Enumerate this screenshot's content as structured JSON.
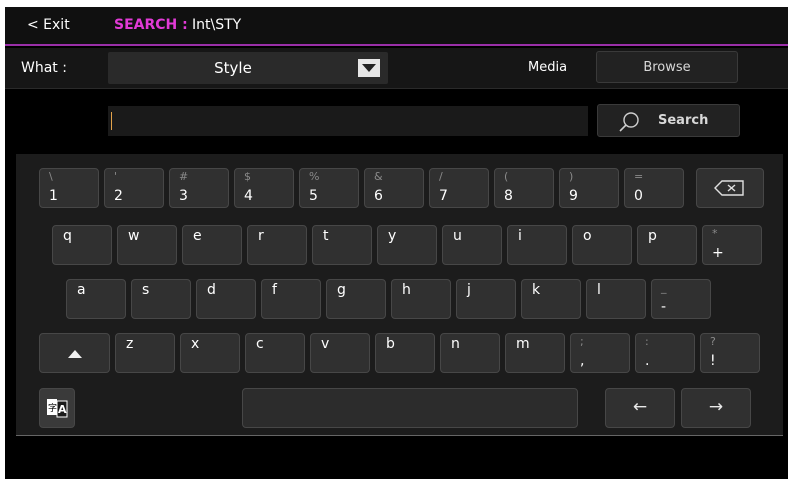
{
  "topbar": {
    "exit_label": "< Exit",
    "search_label": "SEARCH :",
    "search_path": "Int\\STY"
  },
  "what_row": {
    "what_label": "What :",
    "style_value": "Style",
    "media_label": "Media",
    "browse_label": "Browse"
  },
  "search": {
    "value": "",
    "button_label": "Search"
  },
  "keyboard": {
    "row1": [
      {
        "s": "\\",
        "m": "1"
      },
      {
        "s": "'",
        "m": "2"
      },
      {
        "s": "#",
        "m": "3"
      },
      {
        "s": "$",
        "m": "4"
      },
      {
        "s": "%",
        "m": "5"
      },
      {
        "s": "&",
        "m": "6"
      },
      {
        "s": "/",
        "m": "7"
      },
      {
        "s": "(",
        "m": "8"
      },
      {
        "s": ")",
        "m": "9"
      },
      {
        "s": "=",
        "m": "0"
      }
    ],
    "row2": [
      {
        "l": "q"
      },
      {
        "l": "w"
      },
      {
        "l": "e"
      },
      {
        "l": "r"
      },
      {
        "l": "t"
      },
      {
        "l": "y"
      },
      {
        "l": "u"
      },
      {
        "l": "i"
      },
      {
        "l": "o"
      },
      {
        "l": "p"
      },
      {
        "s": "*",
        "m": "+"
      }
    ],
    "row3": [
      {
        "l": "a"
      },
      {
        "l": "s"
      },
      {
        "l": "d"
      },
      {
        "l": "f"
      },
      {
        "l": "g"
      },
      {
        "l": "h"
      },
      {
        "l": "j"
      },
      {
        "l": "k"
      },
      {
        "l": "l"
      },
      {
        "s": "_",
        "m": "-"
      }
    ],
    "row4": [
      {
        "l": "z"
      },
      {
        "l": "x"
      },
      {
        "l": "c"
      },
      {
        "l": "v"
      },
      {
        "l": "b"
      },
      {
        "l": "n"
      },
      {
        "l": "m"
      },
      {
        "s": ";",
        "m": ","
      },
      {
        "s": ":",
        "m": "."
      },
      {
        "s": "?",
        "m": "!"
      }
    ],
    "icons": {
      "backspace": "backspace-icon",
      "shift": "shift-icon",
      "language": "language-icon",
      "search": "search-icon",
      "dropdown": "triangle-down-icon",
      "left": "arrow-left-icon",
      "right": "arrow-right-icon"
    },
    "arrows": {
      "left": "←",
      "right": "→"
    }
  },
  "colors": {
    "accent": "#e13ad6",
    "divider": "#9a2fa8",
    "caret": "#e2a24a"
  }
}
